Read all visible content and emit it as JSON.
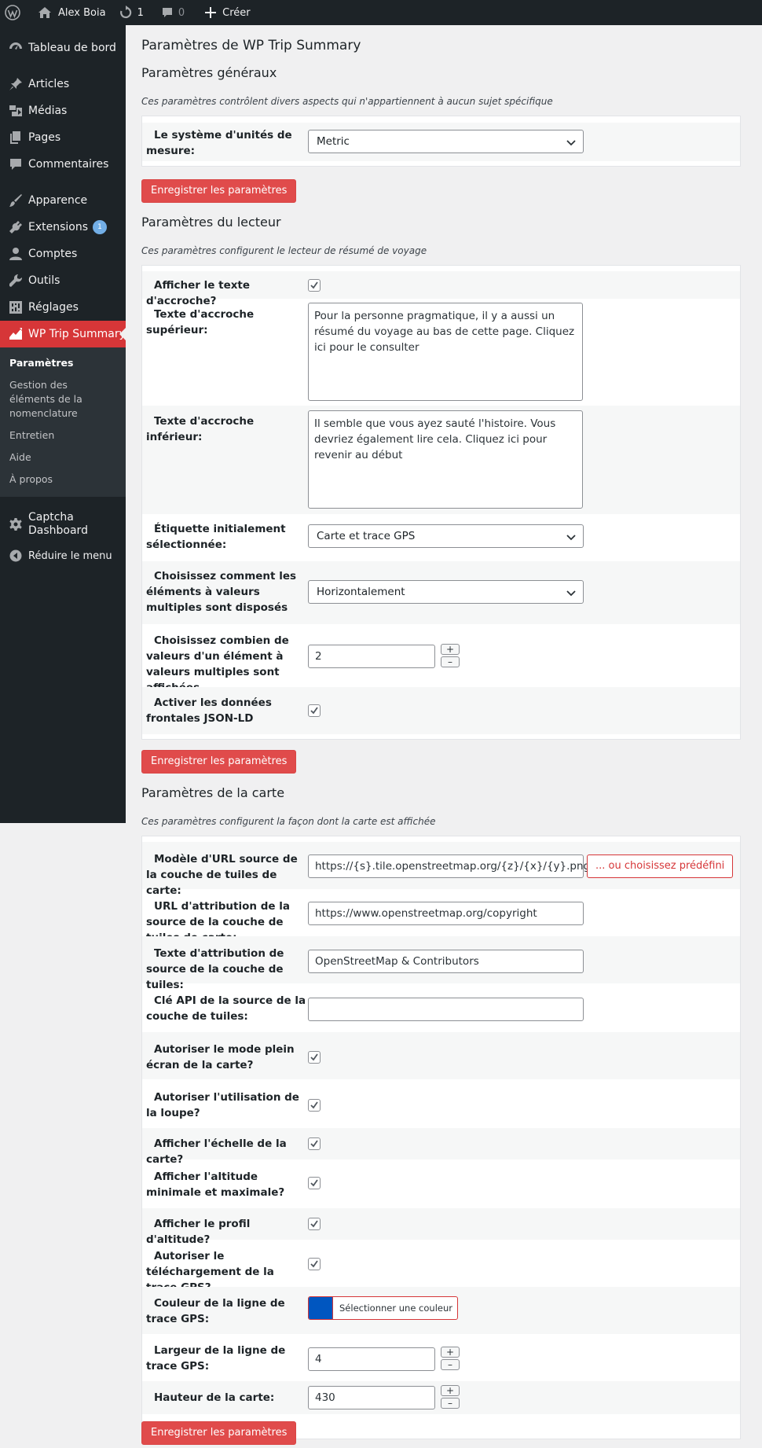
{
  "admin_bar": {
    "site_name": "Alex Boia",
    "updates_count": "1",
    "comments_count": "0",
    "new_label": "Créer"
  },
  "sidebar": {
    "items": [
      {
        "label": "Tableau de bord",
        "icon": "dashboard-icon"
      },
      {
        "label": "Articles",
        "icon": "pin-icon"
      },
      {
        "label": "Médias",
        "icon": "media-icon"
      },
      {
        "label": "Pages",
        "icon": "pages-icon"
      },
      {
        "label": "Commentaires",
        "icon": "comment-icon"
      },
      {
        "label": "Apparence",
        "icon": "brush-icon"
      },
      {
        "label": "Extensions",
        "icon": "plugin-icon",
        "badge": "1"
      },
      {
        "label": "Comptes",
        "icon": "user-icon"
      },
      {
        "label": "Outils",
        "icon": "wrench-icon"
      },
      {
        "label": "Réglages",
        "icon": "settings-icon"
      },
      {
        "label": "WP Trip Summary",
        "icon": "chart-line-icon"
      }
    ],
    "submenu": [
      {
        "label": "Paramètres"
      },
      {
        "label": "Gestion des éléments de la nomenclature"
      },
      {
        "label": "Entretien"
      },
      {
        "label": "Aide"
      },
      {
        "label": "À propos"
      }
    ],
    "captcha": "Captcha Dashboard",
    "collapse": "Réduire le menu"
  },
  "page": {
    "title": "Paramètres de WP Trip Summary",
    "save_label": "Enregistrer les paramètres"
  },
  "general": {
    "heading": "Paramètres généraux",
    "description": "Ces paramètres contrôlent divers aspects qui n'appartiennent à aucun sujet spécifique",
    "unit_label": "Le système d'unités de mesure:",
    "unit_value": "Metric"
  },
  "viewer": {
    "heading": "Paramètres du lecteur",
    "description": "Ces paramètres configurent le lecteur de résumé de voyage",
    "teaser_label": "Afficher le texte d'accroche?",
    "top_teaser_label": "Texte d'accroche supérieur:",
    "top_teaser_value": "Pour la personne pragmatique, il y a aussi un résumé du voyage au bas de cette page. Cliquez ici pour le consulter",
    "bottom_teaser_label": "Texte d'accroche inférieur:",
    "bottom_teaser_value": "Il semble que vous ayez sauté l'histoire. Vous devriez également lire cela. Cliquez ici pour revenir au début",
    "initial_tab_label": "Étiquette initialement sélectionnée:",
    "initial_tab_value": "Carte et trace GPS",
    "layout_label": "Choisissez comment les éléments à valeurs multiples sont disposés",
    "layout_value": "Horizontalement",
    "count_label": "Choisissez combien de valeurs d'un élément à valeurs multiples sont affichées",
    "count_value": "2",
    "jsonld_label": "Activer les données frontales JSON-LD"
  },
  "map": {
    "heading": "Paramètres de la carte",
    "description": "Ces paramètres configurent la façon dont la carte est affichée",
    "tile_url_label": "Modèle d'URL source de la couche de tuiles de carte:",
    "tile_url_value": "https://{s}.tile.openstreetmap.org/{z}/{x}/{y}.png",
    "predefined_label": "... ou choisissez prédéfini",
    "attr_url_label": "URL d'attribution de la source de la couche de tuiles de carte:",
    "attr_url_value": "https://www.openstreetmap.org/copyright",
    "attr_text_label": "Texte d'attribution de source de la couche de tuiles:",
    "attr_text_value": "OpenStreetMap & Contributors",
    "api_key_label": "Clé API de la source de la couche de tuiles:",
    "api_key_value": "",
    "fullscreen_label": "Autoriser le mode plein écran de la carte?",
    "magnifier_label": "Autoriser l'utilisation de la loupe?",
    "scale_label": "Afficher l'échelle de la carte?",
    "minmax_label": "Afficher l'altitude minimale et maximale?",
    "profile_label": "Afficher le profil d'altitude?",
    "download_label": "Autoriser le téléchargement de la trace GPS?",
    "line_color_label": "Couleur de la ligne de trace GPS:",
    "line_color_value": "#0056c0",
    "color_button": "Sélectionner une couleur",
    "line_width_label": "Largeur de la ligne de trace GPS:",
    "line_width_value": "4",
    "height_label": "Hauteur de la carte:",
    "height_value": "430"
  },
  "stepper": {
    "plus": "+",
    "minus": "–"
  }
}
